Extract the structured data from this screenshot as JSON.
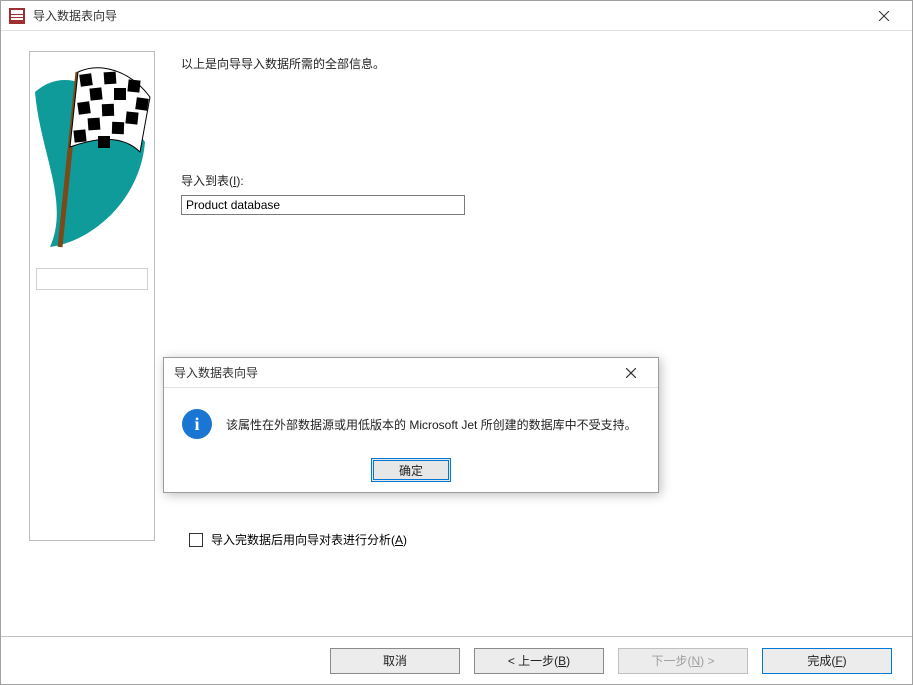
{
  "window": {
    "title": "导入数据表向导"
  },
  "wizard": {
    "intro": "以上是向导导入数据所需的全部信息。",
    "import_to_label_pre": "导入到表(",
    "import_to_label_ul": "I",
    "import_to_label_post": "):",
    "table_value": "Product database",
    "analyze_label_pre": "导入完数据后用向导对表进行分析(",
    "analyze_label_ul": "A",
    "analyze_label_post": ")"
  },
  "footer": {
    "cancel": "取消",
    "back_pre": "< 上一步(",
    "back_ul": "B",
    "back_post": ")",
    "next_pre": "下一步(",
    "next_ul": "N",
    "next_post": ") >",
    "finish_pre": "完成(",
    "finish_ul": "F",
    "finish_post": ")"
  },
  "alert": {
    "title": "导入数据表向导",
    "message": "该属性在外部数据源或用低版本的 Microsoft Jet 所创建的数据库中不受支持。",
    "ok": "确定",
    "icon_glyph": "i"
  }
}
